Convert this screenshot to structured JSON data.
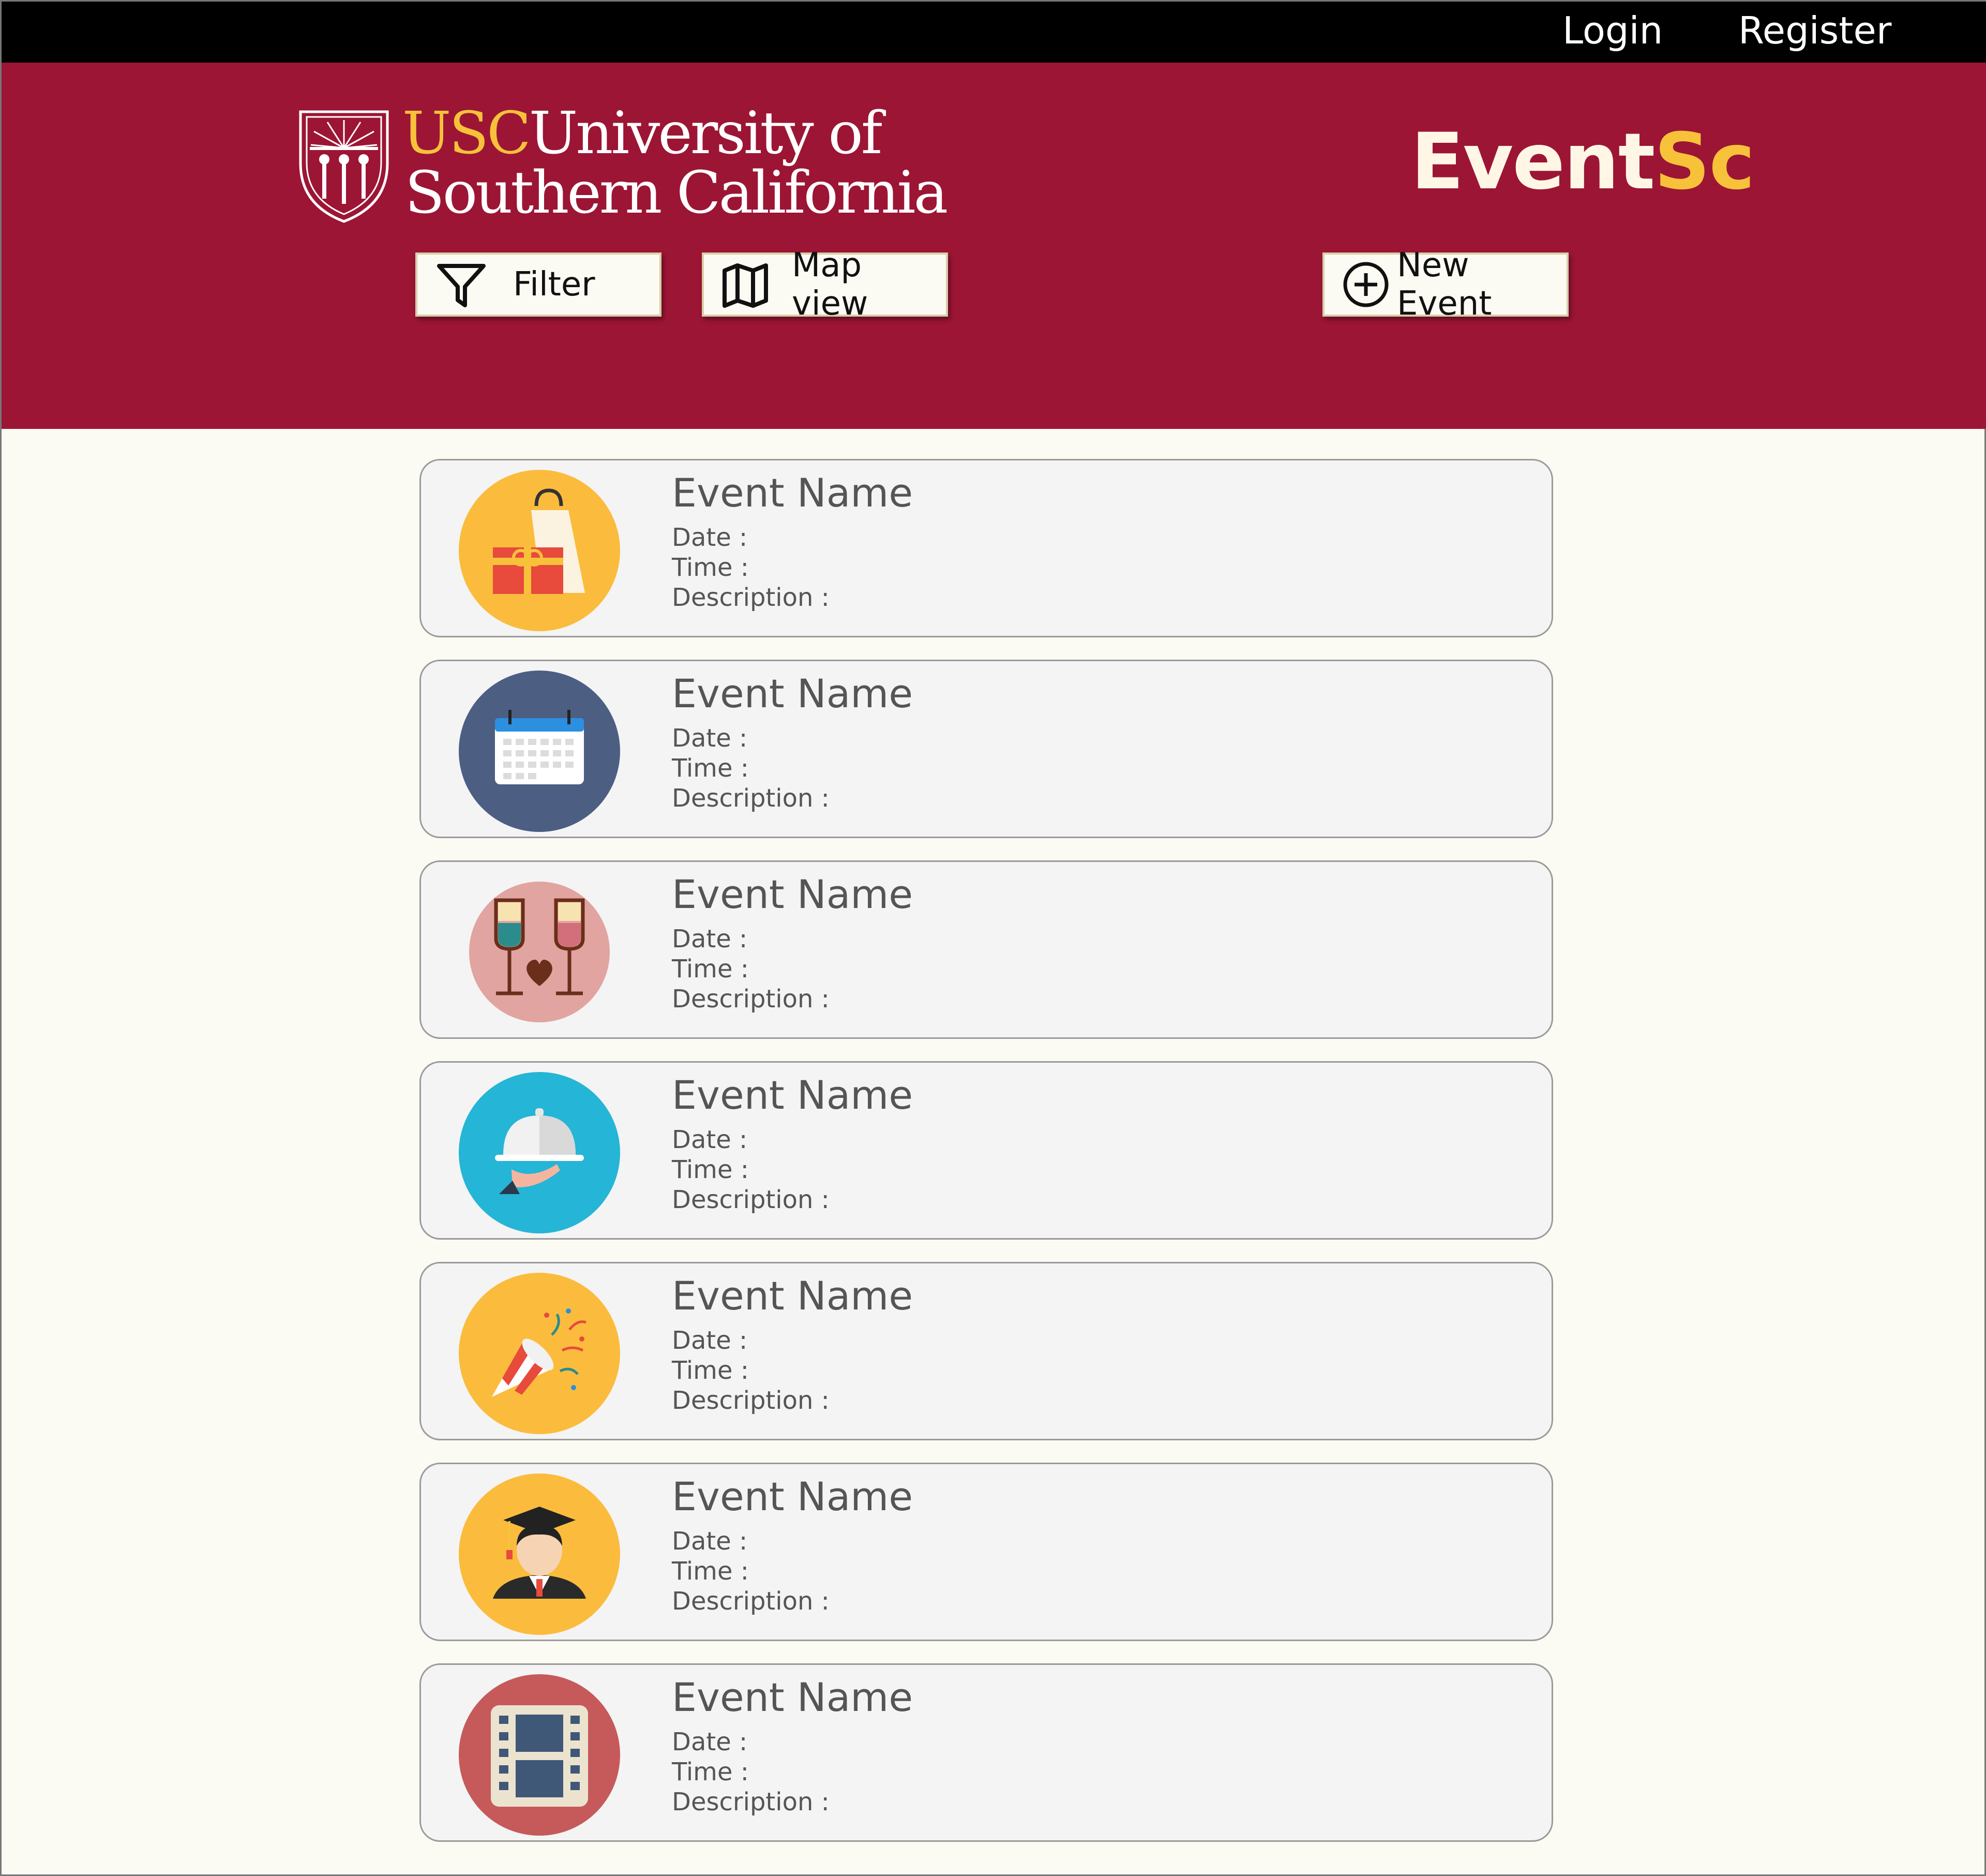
{
  "topbar": {
    "login": "Login",
    "register": "Register"
  },
  "header": {
    "logo": {
      "usc": "USC",
      "line1_rest": "University of",
      "line2": "Southern California"
    },
    "brand_main": "Event",
    "brand_accent": "Sc",
    "filter_label": "Filter",
    "mapview_label": "Map view",
    "newevent_label": "New Event",
    "colors": {
      "header_bg": "#9c1535",
      "accent": "#f7c23a",
      "topbar_bg": "#000000",
      "page_bg": "#fbfaf3"
    }
  },
  "events": [
    {
      "name": "Event Name",
      "date_label": "Date :",
      "time_label": "Time :",
      "desc_label": "Description :",
      "icon": "shopping-gift-icon"
    },
    {
      "name": "Event Name",
      "date_label": "Date :",
      "time_label": "Time :",
      "desc_label": "Description :",
      "icon": "calendar-icon"
    },
    {
      "name": "Event Name",
      "date_label": "Date :",
      "time_label": "Time :",
      "desc_label": "Description :",
      "icon": "wine-glasses-icon"
    },
    {
      "name": "Event Name",
      "date_label": "Date :",
      "time_label": "Time :",
      "desc_label": "Description :",
      "icon": "food-cloche-icon"
    },
    {
      "name": "Event Name",
      "date_label": "Date :",
      "time_label": "Time :",
      "desc_label": "Description :",
      "icon": "party-popper-icon"
    },
    {
      "name": "Event Name",
      "date_label": "Date :",
      "time_label": "Time :",
      "desc_label": "Description :",
      "icon": "graduate-icon"
    },
    {
      "name": "Event Name",
      "date_label": "Date :",
      "time_label": "Time :",
      "desc_label": "Description :",
      "icon": "film-icon"
    }
  ]
}
